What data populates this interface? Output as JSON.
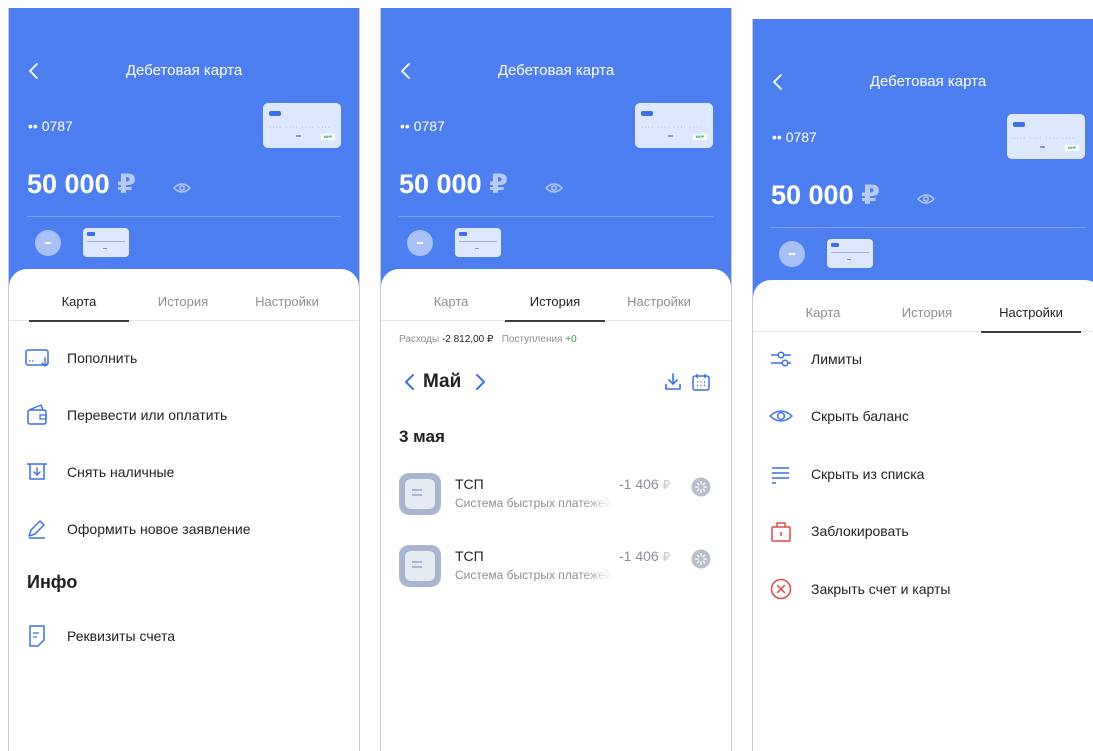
{
  "screens": [
    {
      "title": "Дебетовая карта",
      "account": "•• 0787",
      "balance": "50 000",
      "currency": "₽",
      "card_brand": "МИР",
      "tabs": [
        "Карта",
        "История",
        "Настройки"
      ],
      "active_tab": 0,
      "menu": [
        {
          "label": "Пополнить",
          "icon": "topup-icon"
        },
        {
          "label": "Перевести или оплатить",
          "icon": "wallet-icon"
        },
        {
          "label": "Снять наличные",
          "icon": "withdraw-icon"
        },
        {
          "label": "Оформить новое заявление",
          "icon": "pen-icon"
        }
      ],
      "info_title": "Инфо",
      "info_items": [
        {
          "label": "Реквизиты счета",
          "icon": "document-icon"
        }
      ]
    },
    {
      "title": "Дебетовая карта",
      "account": "•• 0787",
      "balance": "50 000",
      "currency": "₽",
      "card_brand": "МИР",
      "tabs": [
        "Карта",
        "История",
        "Настройки"
      ],
      "active_tab": 1,
      "stats": {
        "expenses_label": "Расходы",
        "expenses_value": "-2 812,00 ₽",
        "income_label": "Поступления",
        "income_value": "+0"
      },
      "month": "Май",
      "date_header": "3 мая",
      "transactions": [
        {
          "title": "ТСП",
          "subtitle": "Система быстрых платежей",
          "amount": "-1 406",
          "currency": "₽"
        },
        {
          "title": "ТСП",
          "subtitle": "Система быстрых платежей",
          "amount": "-1 406",
          "currency": "₽"
        }
      ]
    },
    {
      "title": "Дебетовая карта",
      "account": "•• 0787",
      "balance": "50 000",
      "currency": "₽",
      "card_brand": "МИР",
      "tabs": [
        "Карта",
        "История",
        "Настройки"
      ],
      "active_tab": 2,
      "settings": [
        {
          "label": "Лимиты",
          "icon": "limits-icon"
        },
        {
          "label": "Скрыть баланс",
          "icon": "eye-icon"
        },
        {
          "label": "Скрыть из списка",
          "icon": "list-icon"
        },
        {
          "label": "Заблокировать",
          "icon": "lock-icon"
        },
        {
          "label": "Закрыть счет и карты",
          "icon": "close-circle-icon"
        }
      ]
    }
  ],
  "colors": {
    "primary": "#4e7ff0",
    "icon_blue": "#3d6fe6",
    "danger": "#e0484a",
    "income_green": "#2e9c4a"
  }
}
